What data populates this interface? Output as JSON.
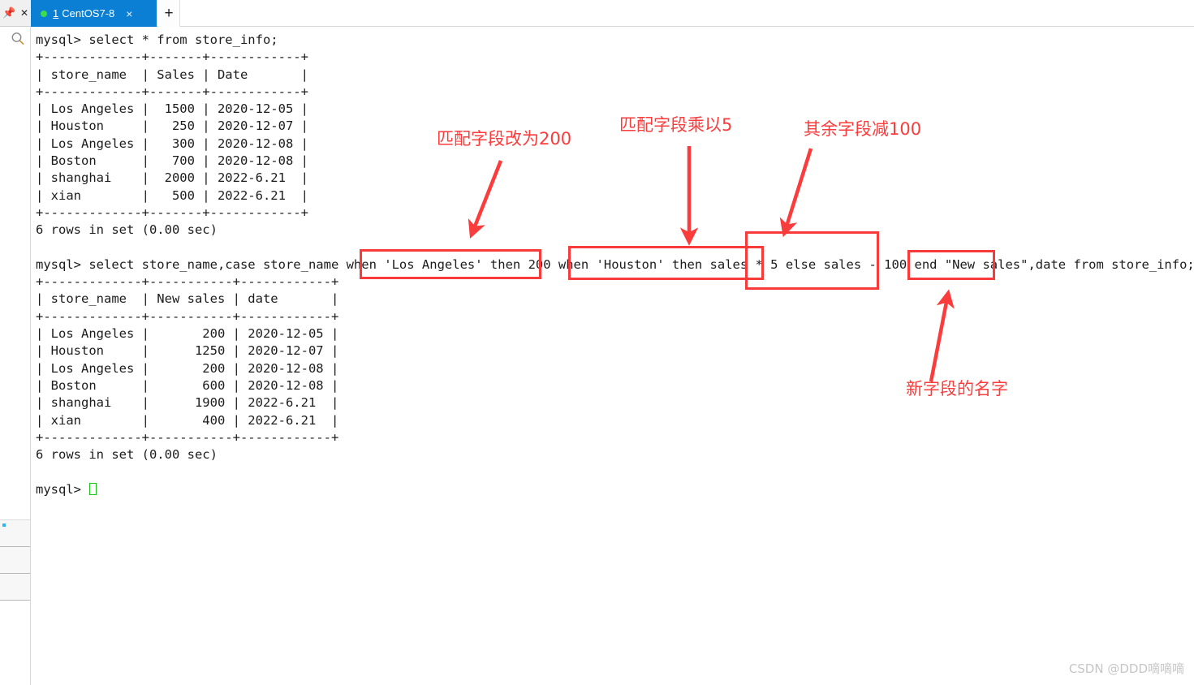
{
  "window": {
    "rail": {
      "pin_icon": "pin-icon",
      "close_icon": "close-icon",
      "search_icon": "search-icon"
    },
    "tab": {
      "number": "1",
      "title": "CentOS7-8",
      "close_label": "×",
      "status_dot_color": "#3ddc4e",
      "active_color": "#0a7fd4"
    },
    "new_tab_label": "+"
  },
  "terminal": {
    "lines": [
      "mysql> select * from store_info;",
      "+-------------+-------+------------+",
      "| store_name  | Sales | Date       |",
      "+-------------+-------+------------+",
      "| Los Angeles |  1500 | 2020-12-05 |",
      "| Houston     |   250 | 2020-12-07 |",
      "| Los Angeles |   300 | 2020-12-08 |",
      "| Boston      |   700 | 2020-12-08 |",
      "| shanghai    |  2000 | 2022-6.21  |",
      "| xian        |   500 | 2022-6.21  |",
      "+-------------+-------+------------+",
      "6 rows in set (0.00 sec)",
      "",
      "mysql> select store_name,case store_name when 'Los Angeles' then 200 when 'Houston' then sales * 5 else sales - 100 end \"New sales\",date from store_info;",
      "+-------------+-----------+------------+",
      "| store_name  | New sales | date       |",
      "+-------------+-----------+------------+",
      "| Los Angeles |       200 | 2020-12-05 |",
      "| Houston     |      1250 | 2020-12-07 |",
      "| Los Angeles |       200 | 2020-12-08 |",
      "| Boston      |       600 | 2020-12-08 |",
      "| shanghai    |      1900 | 2022-6.21  |",
      "| xian        |       400 | 2022-6.21  |",
      "+-------------+-----------+------------+",
      "6 rows in set (0.00 sec)",
      "",
      "mysql> "
    ],
    "prompt": "mysql> ",
    "cursor_color": "#18c518"
  },
  "tables": {
    "first": {
      "query": "select * from store_info;",
      "headers": [
        "store_name",
        "Sales",
        "Date"
      ],
      "rows": [
        [
          "Los Angeles",
          "1500",
          "2020-12-05"
        ],
        [
          "Houston",
          "250",
          "2020-12-07"
        ],
        [
          "Los Angeles",
          "300",
          "2020-12-08"
        ],
        [
          "Boston",
          "700",
          "2020-12-08"
        ],
        [
          "shanghai",
          "2000",
          "2022-6.21"
        ],
        [
          "xian",
          "500",
          "2022-6.21"
        ]
      ],
      "footer": "6 rows in set (0.00 sec)"
    },
    "second": {
      "query": "select store_name,case store_name when 'Los Angeles' then 200 when 'Houston' then sales * 5 else sales - 100 end \"New sales\",date from store_info;",
      "headers": [
        "store_name",
        "New sales",
        "date"
      ],
      "rows": [
        [
          "Los Angeles",
          "200",
          "2020-12-05"
        ],
        [
          "Houston",
          "1250",
          "2020-12-07"
        ],
        [
          "Los Angeles",
          "200",
          "2020-12-08"
        ],
        [
          "Boston",
          "600",
          "2020-12-08"
        ],
        [
          "shanghai",
          "1900",
          "2022-6.21"
        ],
        [
          "xian",
          "400",
          "2022-6.21"
        ]
      ],
      "footer": "6 rows in set (0.00 sec)"
    }
  },
  "annotations": {
    "color": "#fa3c3c",
    "labels": [
      {
        "text": "匹配字段改为200",
        "target": "'Los Angeles' then 200"
      },
      {
        "text": "匹配字段乘以5",
        "target": "'Houston' then sales * 5"
      },
      {
        "text": "其余字段减100",
        "target": "else sales - 100"
      },
      {
        "text": "新字段的名字",
        "target": "\"New sales\""
      }
    ]
  },
  "watermark": "CSDN @DDD嘀嘀嘀"
}
